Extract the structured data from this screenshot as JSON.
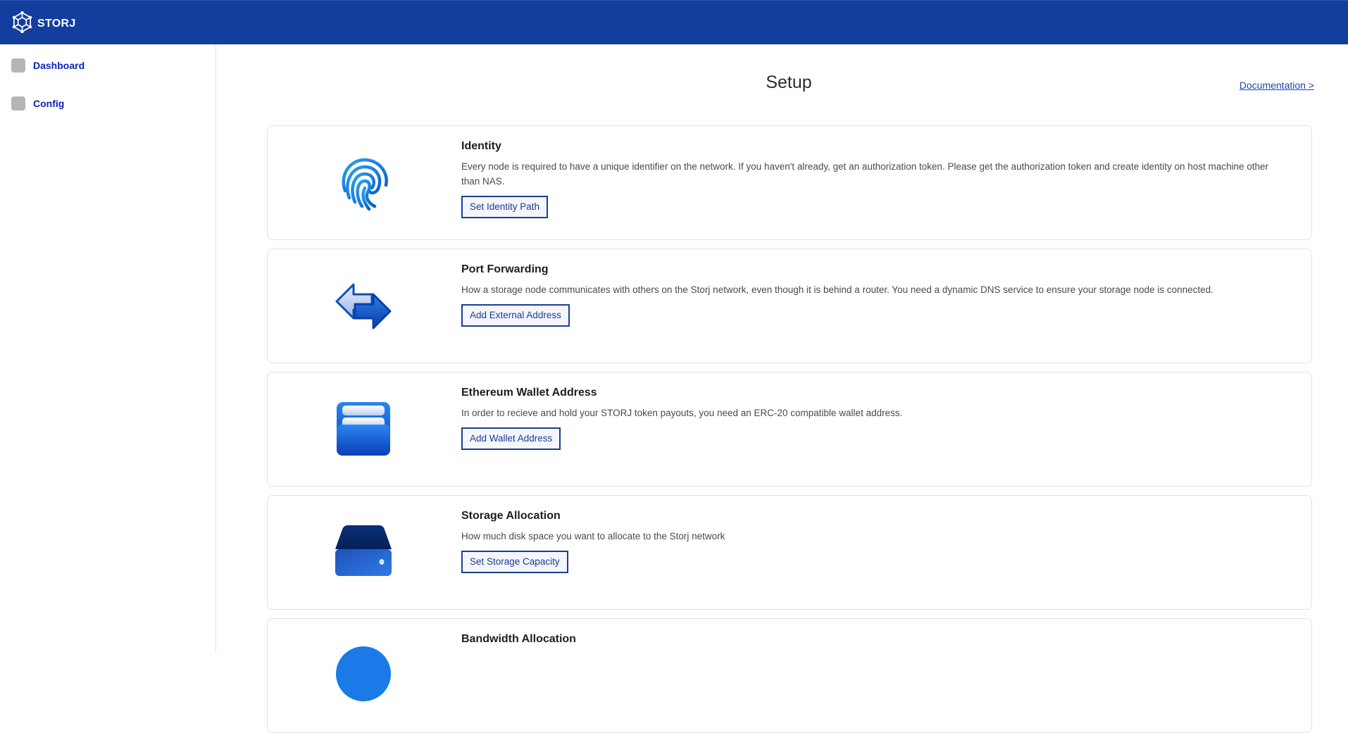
{
  "header": {
    "brand": "STORJ",
    "logo_icon": "storj-logo-icon",
    "color": "#133e9e"
  },
  "sidebar": {
    "items": [
      {
        "label": "Dashboard",
        "icon": "dashboard-icon"
      },
      {
        "label": "Config",
        "icon": "config-icon"
      }
    ]
  },
  "main": {
    "title": "Setup",
    "documentation_link": "Documentation >",
    "cards": [
      {
        "title": "Identity",
        "description": "Every node is required to have a unique identifier on the network. If you haven't already, get an authorization token. Please get the authorization token and create identity on host machine other than NAS.",
        "button": "Set Identity Path",
        "icon": "fingerprint-icon"
      },
      {
        "title": "Port Forwarding",
        "description": "How a storage node communicates with others on the Storj network, even though it is behind a router. You need a dynamic DNS service to ensure your storage node is connected.",
        "button": "Add External Address",
        "icon": "arrows-icon"
      },
      {
        "title": "Ethereum Wallet Address",
        "description": "In order to recieve and hold your STORJ token payouts, you need an ERC-20 compatible wallet address.",
        "button": "Add Wallet Address",
        "icon": "wallet-icon"
      },
      {
        "title": "Storage Allocation",
        "description": "How much disk space you want to allocate to the Storj network",
        "button": "Set Storage Capacity",
        "icon": "hard-drive-icon"
      },
      {
        "title": "Bandwidth Allocation",
        "icon": "bandwidth-icon"
      }
    ]
  },
  "colors": {
    "accent": "#133e9e",
    "link": "#0b22b8",
    "button_border": "#1b3d96"
  }
}
